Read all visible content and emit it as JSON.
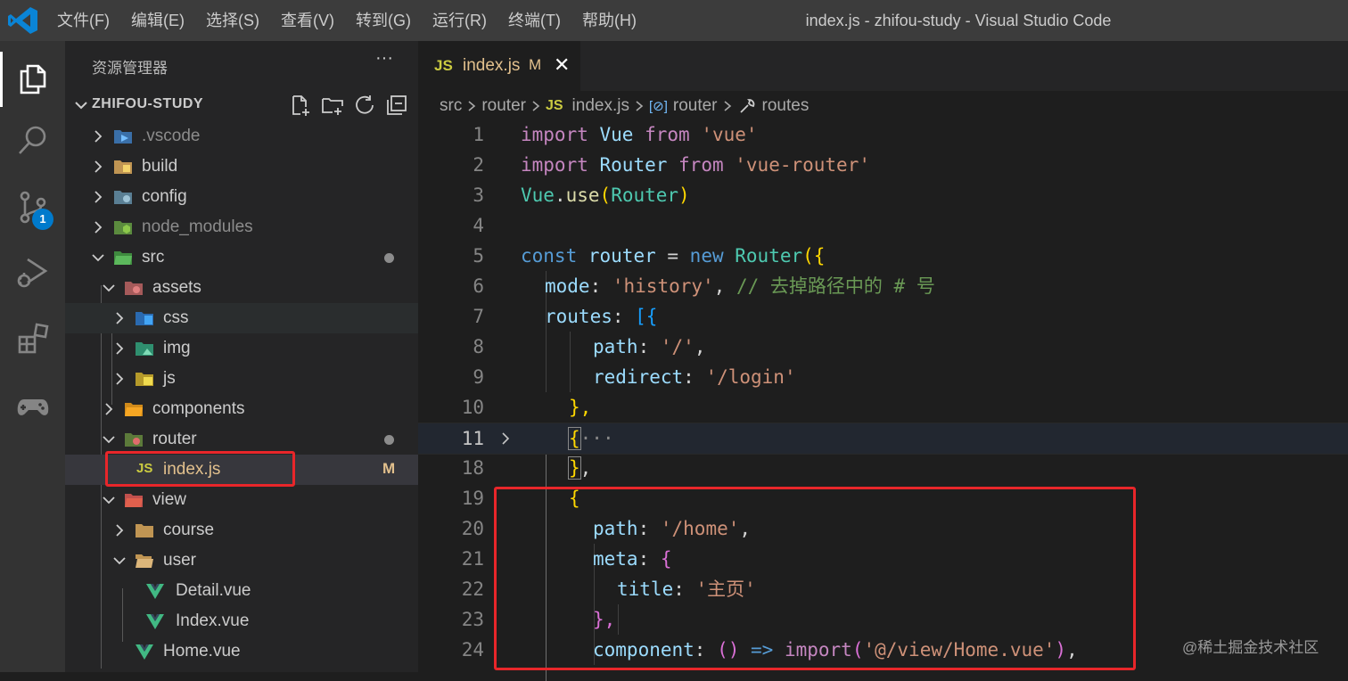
{
  "window": {
    "title": "index.js - zhifou-study - Visual Studio Code",
    "menu": [
      "文件(F)",
      "编辑(E)",
      "选择(S)",
      "查看(V)",
      "转到(G)",
      "运行(R)",
      "终端(T)",
      "帮助(H)"
    ]
  },
  "activity_bar": {
    "items": [
      {
        "name": "explorer",
        "icon": "files-icon",
        "active": true
      },
      {
        "name": "search",
        "icon": "search-icon"
      },
      {
        "name": "source-control",
        "icon": "source-control-icon",
        "badge": "1"
      },
      {
        "name": "run-debug",
        "icon": "run-debug-icon"
      },
      {
        "name": "extensions",
        "icon": "extensions-icon"
      },
      {
        "name": "remote",
        "icon": "gamepad-icon"
      }
    ]
  },
  "sidebar": {
    "title": "资源管理器",
    "more": "···",
    "root": "ZHIFOU-STUDY",
    "root_actions": [
      "new-file-icon",
      "new-folder-icon",
      "refresh-icon",
      "collapse-all-icon"
    ],
    "tree": [
      {
        "label": ".vscode",
        "expanded": false,
        "icon": "vscode-folder-icon",
        "dim": true
      },
      {
        "label": "build",
        "expanded": false,
        "icon": "build-folder-icon"
      },
      {
        "label": "config",
        "expanded": false,
        "icon": "config-folder-icon"
      },
      {
        "label": "node_modules",
        "expanded": false,
        "icon": "node-folder-icon",
        "dim": true
      },
      {
        "label": "src",
        "expanded": true,
        "icon": "src-folder-icon",
        "dot": true
      },
      {
        "label": "assets",
        "expanded": true,
        "icon": "assets-folder-icon"
      },
      {
        "label": "css",
        "expanded": false,
        "icon": "css-folder-icon"
      },
      {
        "label": "img",
        "expanded": false,
        "icon": "img-folder-icon"
      },
      {
        "label": "js",
        "expanded": false,
        "icon": "js-folder-icon"
      },
      {
        "label": "components",
        "expanded": false,
        "icon": "components-folder-icon"
      },
      {
        "label": "router",
        "expanded": true,
        "icon": "router-folder-icon",
        "dot": true
      },
      {
        "label": "index.js",
        "file": true,
        "icon": "js-file-icon",
        "status": "M",
        "selected": true
      },
      {
        "label": "view",
        "expanded": true,
        "icon": "view-folder-icon"
      },
      {
        "label": "course",
        "expanded": false,
        "icon": "folder-icon"
      },
      {
        "label": "user",
        "expanded": true,
        "icon": "folder-open-icon"
      },
      {
        "label": "Detail.vue",
        "file": true,
        "icon": "vue-file-icon"
      },
      {
        "label": "Index.vue",
        "file": true,
        "icon": "vue-file-icon"
      },
      {
        "label": "Home.vue",
        "file": true,
        "icon": "vue-file-icon"
      }
    ]
  },
  "editor": {
    "tab": {
      "icon": "JS",
      "label": "index.js",
      "status": "M",
      "close": "✕"
    },
    "breadcrumb": {
      "src": "src",
      "router": "router",
      "js": "JS",
      "file": "index.js",
      "sym_icon": "[⊘]",
      "symbol": "router",
      "prop": "routes"
    },
    "line_numbers": [
      "1",
      "2",
      "3",
      "4",
      "5",
      "6",
      "7",
      "8",
      "9",
      "10",
      "11",
      "18",
      "19",
      "20",
      "21",
      "22",
      "23",
      "24"
    ],
    "current_line": "11",
    "fold_line": "11",
    "code": {
      "l1": {
        "kw": "import",
        "name": "Vue",
        "from": "from",
        "str": "'vue'"
      },
      "l2": {
        "kw": "import",
        "name": "Router",
        "from": "from",
        "str": "'vue-router'"
      },
      "l3": {
        "obj": "Vue",
        "dot": ".",
        "fn": "use",
        "lp": "(",
        "arg": "Router",
        "rp": ")"
      },
      "l5": {
        "kw": "const",
        "name": "router",
        "eq": " = ",
        "new": "new",
        "cls": "Router",
        "open": "({"
      },
      "l6": {
        "key": "mode",
        "colon": ": ",
        "str": "'history'",
        "comma": ", ",
        "comment": "// 去掉路径中的 # 号"
      },
      "l7": {
        "key": "routes",
        "colon": ": ",
        "open": "[{"
      },
      "l8": {
        "key": "path",
        "colon": ": ",
        "str": "'/'",
        "comma": ","
      },
      "l9": {
        "key": "redirect",
        "colon": ": ",
        "str": "'/login'"
      },
      "l10": {
        "close": "},"
      },
      "l11": {
        "open": "{",
        "ellipsis": "···"
      },
      "l18": {
        "close": "}",
        "comma": ","
      },
      "l19": {
        "open": "{"
      },
      "l20": {
        "key": "path",
        "colon": ": ",
        "str": "'/home'",
        "comma": ","
      },
      "l21": {
        "key": "meta",
        "colon": ": ",
        "open": "{"
      },
      "l22": {
        "key": "title",
        "colon": ": ",
        "str": "'主页'"
      },
      "l23": {
        "close": "},"
      },
      "l24": {
        "key": "component",
        "colon": ": ",
        "args": "()",
        "arrow": " => ",
        "fn": "import",
        "lp": "(",
        "str": "'@/view/Home.vue'",
        "rp": ")",
        "comma": ","
      }
    }
  },
  "annotations": {
    "color": "#e8262a"
  },
  "watermark": "@稀土掘金技术社区",
  "colors": {
    "titlebar": "#3c3c3c",
    "activitybar": "#333333",
    "sidebar": "#252526",
    "editor": "#1e1e1e",
    "accent": "#007acc",
    "modified": "#e2c08d"
  }
}
